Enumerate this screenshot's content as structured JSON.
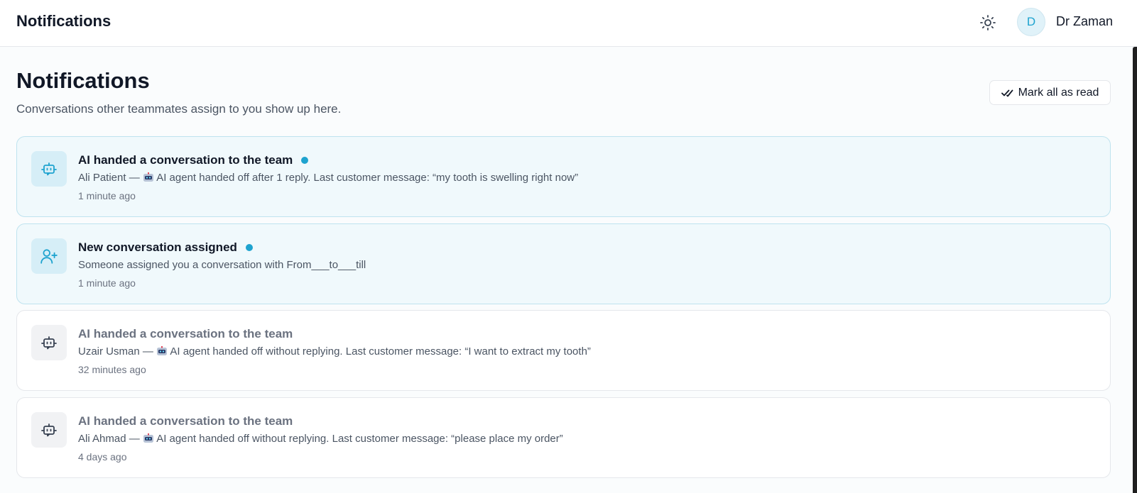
{
  "header": {
    "title": "Notifications",
    "theme_icon": "sun-icon",
    "avatar_initial": "D",
    "user_name": "Dr Zaman"
  },
  "page": {
    "title": "Notifications",
    "subtitle": "Conversations other teammates assign to you show up here.",
    "mark_all_label": "Mark all as read"
  },
  "colors": {
    "accent": "#1ea3cf",
    "unread_bg": "#f0f9fc",
    "unread_border": "#bfe3ef"
  },
  "notifications": [
    {
      "icon": "bot-icon",
      "unread": true,
      "title": "AI handed a conversation to the team",
      "body_prefix": "Ali Patient — ",
      "emoji": "robot-emoji",
      "body_text": " AI agent handed off after 1 reply. Last customer message: “my tooth is swelling right now”",
      "time": "1 minute ago"
    },
    {
      "icon": "user-plus-icon",
      "unread": true,
      "title": "New conversation assigned",
      "body_prefix": "Someone assigned you a conversation with From___to___till",
      "emoji": "",
      "body_text": "",
      "time": "1 minute ago"
    },
    {
      "icon": "bot-icon",
      "unread": false,
      "title": "AI handed a conversation to the team",
      "body_prefix": "Uzair Usman — ",
      "emoji": "robot-emoji",
      "body_text": " AI agent handed off without replying. Last customer message: “I want to extract my tooth”",
      "time": "32 minutes ago"
    },
    {
      "icon": "bot-icon",
      "unread": false,
      "title": "AI handed a conversation to the team",
      "body_prefix": "Ali Ahmad — ",
      "emoji": "robot-emoji",
      "body_text": " AI agent handed off without replying. Last customer message: “please place my order”",
      "time": "4 days ago"
    }
  ]
}
